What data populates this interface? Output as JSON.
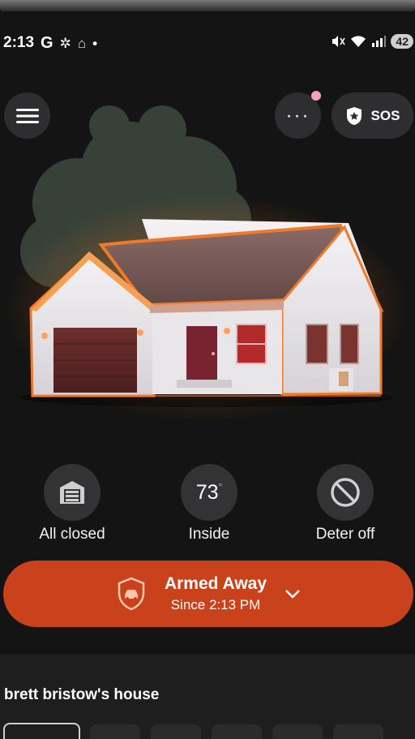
{
  "status_bar": {
    "time": "2:13",
    "left_icons": [
      "G",
      "✲",
      "⌂",
      "•"
    ],
    "battery": "42"
  },
  "header": {
    "sos_label": "SOS",
    "more_label": "···"
  },
  "stats": {
    "garage": {
      "label": "All closed"
    },
    "temperature": {
      "value": "73",
      "unit": "°",
      "label": "Inside"
    },
    "deter": {
      "label": "Deter off"
    }
  },
  "armed": {
    "title": "Armed Away",
    "subtitle": "Since 2:13 PM"
  },
  "home": {
    "name": "brett bristow's house"
  },
  "colors": {
    "accent": "#c9421c",
    "background": "#141414",
    "button": "#2e2e30"
  }
}
